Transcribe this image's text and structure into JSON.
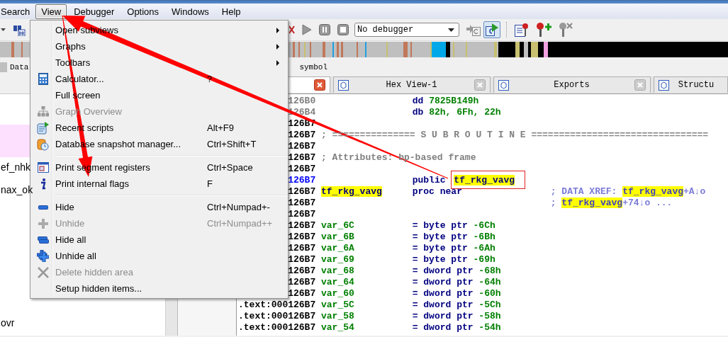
{
  "menubar": [
    {
      "label": "Search",
      "selected": false
    },
    {
      "label": "View",
      "selected": true
    },
    {
      "label": "Debugger",
      "selected": false
    },
    {
      "label": "Options",
      "selected": false
    },
    {
      "label": "Windows",
      "selected": false
    },
    {
      "label": "Help",
      "selected": false
    }
  ],
  "toolbar": {
    "debugger_select": "No debugger"
  },
  "legend": [
    "Data",
    "symbol"
  ],
  "tabs": [
    {
      "selected": true
    },
    {
      "label": "Hex View-1",
      "selected": false
    },
    {
      "label": "Exports",
      "selected": false
    },
    {
      "label": "Structu",
      "selected": false
    }
  ],
  "function_list": {
    "items": [
      "ef_nhk",
      "nax_ok",
      "ovr"
    ]
  },
  "view_menu": {
    "items": [
      {
        "kind": "submenu",
        "label": "Open subviews",
        "disabled": false
      },
      {
        "kind": "submenu",
        "label": "Graphs",
        "disabled": false
      },
      {
        "kind": "submenu",
        "label": "Toolbars",
        "disabled": false
      },
      {
        "kind": "command",
        "label": "Calculator...",
        "shortcut": "?",
        "disabled": false
      },
      {
        "kind": "command",
        "label": "Full screen",
        "disabled": false
      },
      {
        "kind": "command",
        "label": "Graph Overview",
        "disabled": true
      },
      {
        "kind": "command",
        "label": "Recent scripts",
        "shortcut": "Alt+F9",
        "disabled": false
      },
      {
        "kind": "command",
        "label": "Database snapshot manager...",
        "shortcut": "Ctrl+Shift+T",
        "disabled": false
      },
      {
        "kind": "separator"
      },
      {
        "kind": "command",
        "label": "Print segment registers",
        "shortcut": "Ctrl+Space",
        "disabled": false
      },
      {
        "kind": "command",
        "label": "Print internal flags",
        "shortcut": "F",
        "disabled": false
      },
      {
        "kind": "separator"
      },
      {
        "kind": "command",
        "label": "Hide",
        "shortcut": "Ctrl+Numpad+-",
        "disabled": false
      },
      {
        "kind": "command",
        "label": "Unhide",
        "shortcut": "Ctrl+Numpad++",
        "disabled": true
      },
      {
        "kind": "command",
        "label": "Hide all",
        "disabled": false
      },
      {
        "kind": "command",
        "label": "Unhide all",
        "disabled": false
      },
      {
        "kind": "command",
        "label": "Delete hidden area",
        "disabled": true
      },
      {
        "kind": "command",
        "label": "Setup hidden items...",
        "disabled": false
      }
    ]
  },
  "disassembly": {
    "lines": [
      {
        "address": "126B0",
        "kind": "data",
        "instruction": [
          {
            "text": "dd ",
            "kind": "keyword"
          },
          {
            "text": "7825B149h",
            "kind": "number"
          }
        ]
      },
      {
        "address": "126B4",
        "kind": "data",
        "instruction": [
          {
            "text": "db ",
            "kind": "keyword"
          },
          {
            "text": "82h, 6Fh, 22h",
            "kind": "number"
          }
        ]
      },
      {
        "address": "126B7",
        "kind": "code"
      },
      {
        "address": "126B7",
        "kind": "code",
        "note": "; =============== S U B R O U T I N E ================================"
      },
      {
        "address": "126B7",
        "kind": "code"
      },
      {
        "address": "126B7",
        "kind": "code",
        "note": "; Attributes: bp-based frame"
      },
      {
        "address": "126B7",
        "kind": "code"
      },
      {
        "address": "126B7",
        "kind": "current",
        "instruction": [
          {
            "text": "public ",
            "kind": "keyword"
          },
          {
            "text": "tf_rkg_vavg",
            "kind": "framed"
          }
        ]
      },
      {
        "address": "126B7",
        "kind": "code",
        "label": {
          "text": "tf_rkg_vavg",
          "kind": "symbol"
        },
        "instruction": [
          {
            "text": "proc near",
            "kind": "keyword"
          }
        ],
        "comment": [
          {
            "text": "; DATA XREF: ",
            "kind": "comment"
          },
          {
            "text": "tf_rkg_vavg",
            "kind": "symbol"
          },
          {
            "text": "+A↓o",
            "kind": "comment"
          }
        ]
      },
      {
        "address": "126B7",
        "kind": "code",
        "comment": [
          {
            "text": "; ",
            "kind": "comment"
          },
          {
            "text": "tf_rkg_vavg",
            "kind": "symbol"
          },
          {
            "text": "+74↓o ...",
            "kind": "comment"
          }
        ]
      },
      {
        "address": "126B7",
        "kind": "code"
      },
      {
        "address": "126B7",
        "kind": "code",
        "label": {
          "text": "var_6C",
          "kind": "var"
        },
        "instruction": [
          {
            "text": "= byte ptr ",
            "kind": "keyword"
          },
          {
            "text": "-6Ch",
            "kind": "number"
          }
        ]
      },
      {
        "address": "126B7",
        "kind": "code",
        "label": {
          "text": "var_6B",
          "kind": "var"
        },
        "instruction": [
          {
            "text": "= byte ptr ",
            "kind": "keyword"
          },
          {
            "text": "-6Bh",
            "kind": "number"
          }
        ]
      },
      {
        "address": "126B7",
        "kind": "code",
        "label": {
          "text": "var_6A",
          "kind": "var"
        },
        "instruction": [
          {
            "text": "= byte ptr ",
            "kind": "keyword"
          },
          {
            "text": "-6Ah",
            "kind": "number"
          }
        ]
      },
      {
        "address": "126B7",
        "kind": "code",
        "label": {
          "text": "var_69",
          "kind": "var"
        },
        "instruction": [
          {
            "text": "= byte ptr ",
            "kind": "keyword"
          },
          {
            "text": "-69h",
            "kind": "number"
          }
        ]
      },
      {
        "address": "126B7",
        "kind": "code",
        "label": {
          "text": "var_68",
          "kind": "var"
        },
        "instruction": [
          {
            "text": "= dword ptr ",
            "kind": "keyword"
          },
          {
            "text": "-68h",
            "kind": "number"
          }
        ]
      },
      {
        "address": "126B7",
        "kind": "code",
        "label": {
          "text": "var_64",
          "kind": "var"
        },
        "instruction": [
          {
            "text": "= dword ptr ",
            "kind": "keyword"
          },
          {
            "text": "-64h",
            "kind": "number"
          }
        ]
      },
      {
        "address": "126B7",
        "kind": "code",
        "label": {
          "text": "var_60",
          "kind": "var"
        },
        "instruction": [
          {
            "text": "= dword ptr ",
            "kind": "keyword"
          },
          {
            "text": "-60h",
            "kind": "number"
          }
        ]
      },
      {
        "address": ".text:000126B7",
        "kind": "code",
        "label": {
          "text": "var_5C",
          "kind": "var"
        },
        "instruction": [
          {
            "text": "= dword ptr ",
            "kind": "keyword"
          },
          {
            "text": "-5Ch",
            "kind": "number"
          }
        ]
      },
      {
        "address": ".text:000126B7",
        "kind": "code",
        "label": {
          "text": "var_58",
          "kind": "var"
        },
        "instruction": [
          {
            "text": "= dword ptr ",
            "kind": "keyword"
          },
          {
            "text": "-58h",
            "kind": "number"
          }
        ]
      },
      {
        "address": ".text:000126B7",
        "kind": "code",
        "label": {
          "text": "var_54",
          "kind": "var"
        },
        "instruction": [
          {
            "text": "= dword ptr ",
            "kind": "keyword"
          },
          {
            "text": "-54h",
            "kind": "number"
          }
        ]
      }
    ]
  }
}
